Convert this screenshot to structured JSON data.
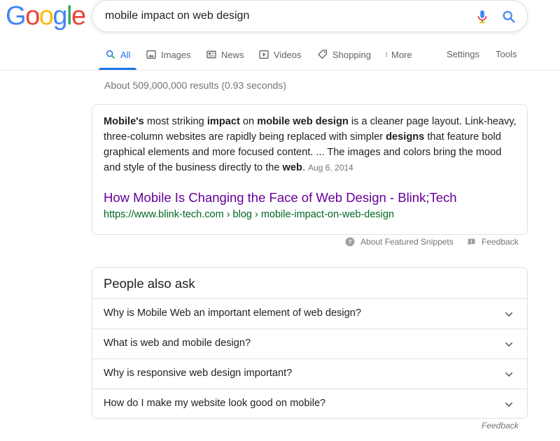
{
  "logo": {
    "letters": [
      "G",
      "o",
      "o",
      "g",
      "l",
      "e"
    ],
    "colors": [
      "#4285F4",
      "#EA4335",
      "#FBBC05",
      "#4285F4",
      "#34A853",
      "#EA4335"
    ]
  },
  "search": {
    "query": "mobile impact on web design"
  },
  "tabs": [
    {
      "label": "All",
      "icon": "search-icon",
      "active": true
    },
    {
      "label": "Images",
      "icon": "image-icon"
    },
    {
      "label": "News",
      "icon": "news-icon"
    },
    {
      "label": "Videos",
      "icon": "video-icon"
    },
    {
      "label": "Shopping",
      "icon": "tag-icon"
    },
    {
      "label": "More",
      "icon": "more-vert-icon"
    }
  ],
  "tools": {
    "settings": "Settings",
    "tools": "Tools"
  },
  "stats": "About 509,000,000 results (0.93 seconds)",
  "snippet": {
    "segments": [
      {
        "t": "Mobile's",
        "b": true
      },
      {
        "t": " most striking ",
        "b": false
      },
      {
        "t": "impact",
        "b": true
      },
      {
        "t": " on ",
        "b": false
      },
      {
        "t": "mobile web design",
        "b": true
      },
      {
        "t": " is a cleaner page layout. Link-heavy, three-column websites are rapidly being replaced with simpler ",
        "b": false
      },
      {
        "t": "designs",
        "b": true
      },
      {
        "t": " that feature bold graphical elements and more focused content. ... The images and colors bring the mood and style of the business directly to the ",
        "b": false
      },
      {
        "t": "web",
        "b": true
      },
      {
        "t": ".",
        "b": false
      }
    ],
    "date": "Aug 6, 2014",
    "title": "How Mobile Is Changing the Face of Web Design - Blink;Tech",
    "url": "https://www.blink-tech.com › blog › mobile-impact-on-web-design"
  },
  "snippet_footer": {
    "about": "About Featured Snippets",
    "feedback": "Feedback"
  },
  "paa": {
    "title": "People also ask",
    "questions": [
      "Why is Mobile Web an important element of web design?",
      "What is web and mobile design?",
      "Why is responsive web design important?",
      "How do I make my website look good on mobile?"
    ]
  },
  "bottom_feedback": "Feedback"
}
